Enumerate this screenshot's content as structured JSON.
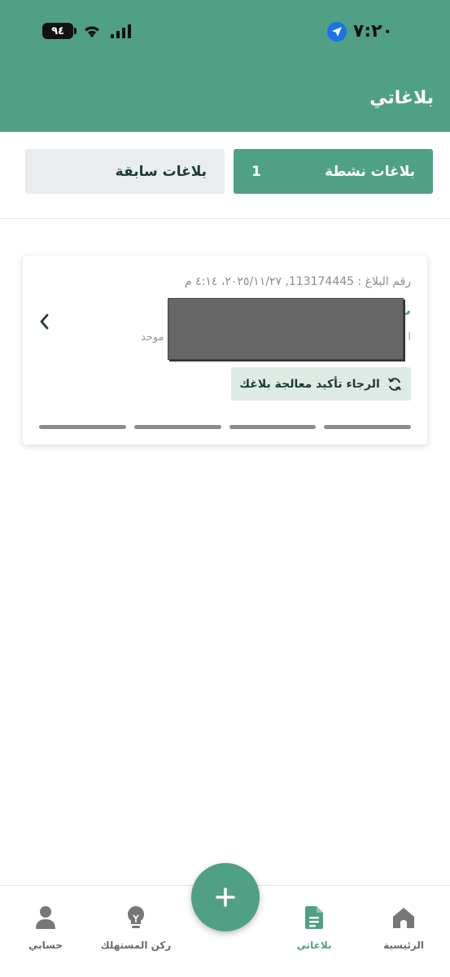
{
  "status_bar": {
    "time": "٧:٢٠",
    "battery": "٩٤"
  },
  "header": {
    "title": "بلاغاتي"
  },
  "tabs": {
    "active": {
      "label": "بلاغات نشطة",
      "count": "1"
    },
    "inactive": {
      "label": "بلاغات سابقة"
    }
  },
  "card": {
    "report_line": "رقم البلاغ : 113174445, ٢٠٢٥/١١/٢٧، ٤:١٤ م",
    "title_fragment": "ث",
    "desc_fragment": "موحد",
    "desc_fragment_right": "ا",
    "confirm_label": "الرجاء تأكيد معالجة بلاغك",
    "progress_steps": 4
  },
  "nav": {
    "home": "الرئيسية",
    "reports": "بلاغاتي",
    "consumer": "ركن المستهلك",
    "account": "حسابي"
  },
  "colors": {
    "primary": "#50a085",
    "tab_inactive": "#e9edf0",
    "confirm_bg": "#dcebe4"
  }
}
